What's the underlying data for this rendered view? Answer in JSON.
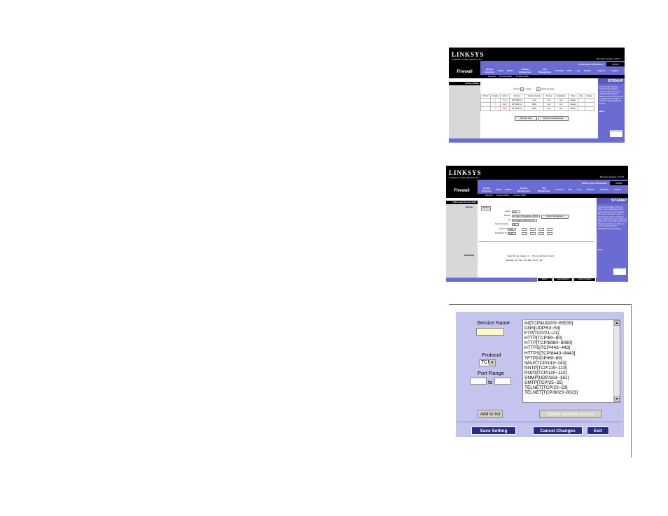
{
  "colors": {
    "brand_blue": "#6b6bd4",
    "dialog_bg": "#c4c4ee",
    "nav_button": "#2a2a8a"
  },
  "brand": {
    "logo": "LINKSYS",
    "subtitle": "A Division of Cisco Systems, Inc."
  },
  "header": {
    "firmware": "Firmware Version: 2.0.0.3",
    "product": "10/100 8-port VPN Router",
    "model": "RV082",
    "section": "Firewall"
  },
  "nav": {
    "tabs": [
      "System Summary",
      "Setup",
      "DHCP",
      "System Management",
      "Port Management",
      "Firewall",
      "VPN",
      "Log",
      "Wizard",
      "Support",
      "Logout"
    ],
    "subtabs": [
      "General",
      "Access Rules",
      "Content Filter"
    ]
  },
  "shot1": {
    "left_title": "Access Rules",
    "pager": {
      "prefix": "Jump to",
      "page": "1",
      "of": "/ 1 page",
      "rows": "5",
      "suffix": "entries per page"
    },
    "columns": [
      "Priority",
      "Enable",
      "Action",
      "Service",
      "Source Interface",
      "Source",
      "Destination",
      "Time",
      "Day",
      "Delete"
    ],
    "rows": [
      [
        "",
        "✓",
        "Allow",
        "All Traffic [1]",
        "LAN",
        "Any",
        "Any",
        "Always",
        "",
        ""
      ],
      [
        "",
        "✓",
        "Deny",
        "All Traffic [1]",
        "WAN",
        "Any",
        "Any",
        "Always",
        "",
        ""
      ],
      [
        "",
        "✓",
        "Deny",
        "All Traffic [1]",
        "DMZ",
        "Any",
        "Any",
        "Always",
        "",
        ""
      ]
    ],
    "add_button": "Add New Rule",
    "restore_button": "Restore to Default Rules",
    "sitemap": "SITEMAP",
    "help_text": "Access Rules: Network Access Rules evaluate network traffic's Source IP address, Destination IP address, and IP protocol type to decide if the IP traffic is allowed to pass through the firewall.",
    "more": "More...",
    "cisco": "Cisco Systems"
  },
  "shot2": {
    "left_title": "Add a new Access Rule",
    "services_label": "Services",
    "scheduling_label": "Scheduling",
    "badge": "Default",
    "action": "Allow",
    "service": "All Traffic [TCP&UDP/1~65535]",
    "service_mgmt": "Service Management",
    "log": "Log packets match this rule",
    "source_interface": "LAN",
    "source_ip": "Single",
    "dest_ip": "Single",
    "schedule_row": "Apply this rule   Always   to      (hh:mm) (24 Hour Format)",
    "days": "Everyday  Sun  Mon  Tue  Wed  Thu  Fri  Sat",
    "field_labels": {
      "action": "Action",
      "service": "Service",
      "log": "Log",
      "source_interface": "Source Interface",
      "source_ip": "Source IP",
      "dest_ip": "Destination IP"
    },
    "footer": {
      "return": "Return",
      "save": "Save Settings",
      "cancel": "Cancel Changes"
    },
    "sitemap": "SITEMAP",
    "help_text": "Action: Select Allow or Deny to allow or deny depending on the intent of the rule. Service: Select the service you want to allow or deny from the Service pull-down menu. If the service you need is not listed in the menu, click the Service Management button to add a new service, and the Service Management screen appears.",
    "more": "More...",
    "cisco": "Cisco Systems"
  },
  "dialog": {
    "service_name_label": "Service Name",
    "service_name_value": "",
    "protocol_label": "Protocol",
    "protocol_value": "TCP",
    "port_range_label": "Port Range",
    "port_from": "",
    "to": "to",
    "port_to": "",
    "services": [
      "All[TCP&UDP/0~65535]",
      "DNS[UDP/53~53]",
      "FTP[TCP/21~21]",
      "HTTP[TCP/80~80]",
      "HTTP[TCP/8080~8080]",
      "HTTPS[TCP/443~443]",
      "HTTPS[TCP/8443~8443]",
      "TFTP[UDP/69~69]",
      "IMAP[TCP/143~143]",
      "NNTP[TCP/119~119]",
      "POP3[TCP/110~110]",
      "SNMP[UDP/161~161]",
      "SMTP[TCP/25~25]",
      "TELNET[TCP/23~23]",
      "TELNET[TCP/8023~8023]"
    ],
    "add_button": "Add to list",
    "delete_button": "Delete selected service",
    "save_button": "Save Setting",
    "cancel_button": "Cancel Changes",
    "exit_button": "Exit"
  }
}
